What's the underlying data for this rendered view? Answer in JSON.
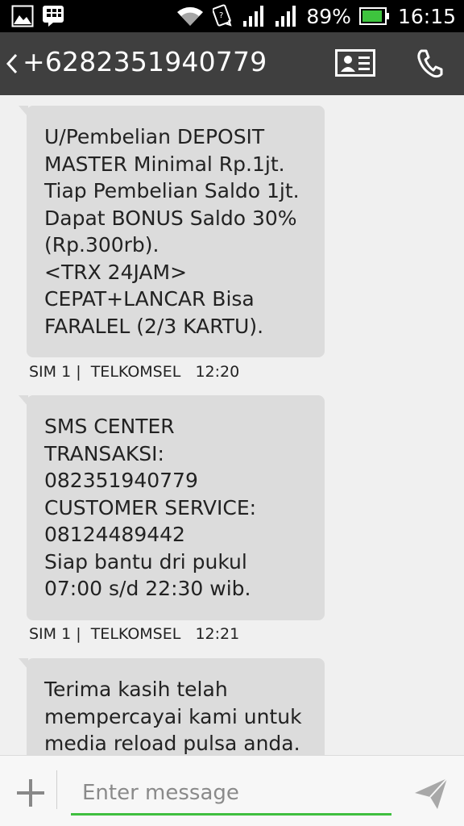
{
  "status_bar": {
    "battery_percent": "89%",
    "time": "16:15",
    "icons": [
      "gallery-icon",
      "bbm-icon",
      "wifi-icon",
      "sync-icon",
      "signal-icon",
      "signal-icon",
      "battery-icon"
    ]
  },
  "header": {
    "title": "+6282351940779",
    "icons": [
      "back-icon",
      "contact-card-icon",
      "phone-icon"
    ]
  },
  "messages": [
    {
      "text": "U/Pembelian DEPOSIT\nMASTER Minimal Rp.1jt.\nTiap Pembelian Saldo 1jt.\nDapat BONUS Saldo 30%\n(Rp.300rb).\n<TRX 24JAM>\nCEPAT+LANCAR Bisa\nFARALEL (2/3 KARTU).",
      "meta": "SIM 1 |  TELKOMSEL   12:20"
    },
    {
      "text": "SMS CENTER\nTRANSAKSI:\n082351940779\nCUSTOMER SERVICE:\n08124489442\nSiap bantu dri pukul\n07:00 s/d 22:30 wib.",
      "meta": "SIM 1 |  TELKOMSEL   12:21"
    },
    {
      "text": "Terima kasih telah\nmempercayai kami untuk\nmedia reload pulsa anda.",
      "meta": ""
    }
  ],
  "compose": {
    "placeholder": "Enter message",
    "value": ""
  },
  "colors": {
    "status_bar": "#000000",
    "action_bar": "#3f3f3f",
    "bubble": "#dcdcdc",
    "background": "#f0f0f0",
    "input_underline": "#3fbf3f",
    "battery_fill": "#3ec43e"
  }
}
